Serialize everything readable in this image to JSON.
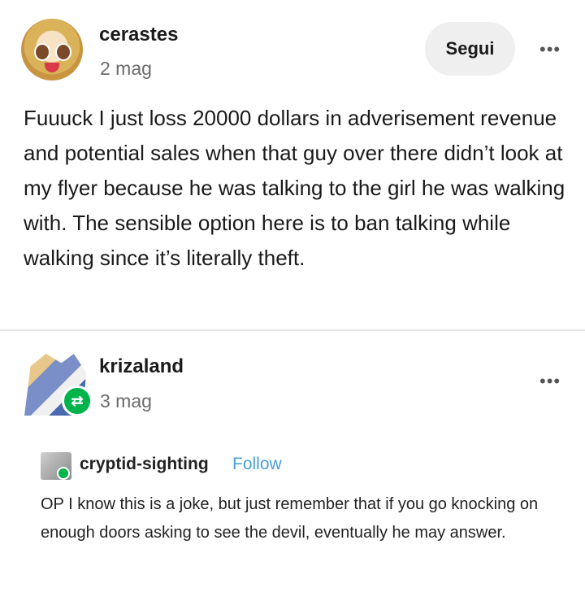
{
  "post": {
    "author": "cerastes",
    "time": "2 mag",
    "follow_label": "Segui",
    "more_icon": "•••",
    "body": "Fuuuck I just loss 20000 dollars in adverisement revenue and potential sales when that guy over there didn’t look at my flyer because he was talking to the girl he was walking with. The sensible option here is to ban talking while walking since it’s literally theft."
  },
  "reblog": {
    "author": "krizaland",
    "time": "3 mag",
    "more_icon": "•••",
    "badge_icon": "reblog-icon",
    "badge_glyph": "⇄",
    "badge_color": "#00b34a",
    "quote": {
      "author": "cryptid-sighting",
      "follow_label": "Follow",
      "follow_color": "#4a9fd8",
      "text": "OP I know this is a joke, but just remember that if you go knocking on enough doors asking to see the devil, eventually he may answer."
    }
  }
}
